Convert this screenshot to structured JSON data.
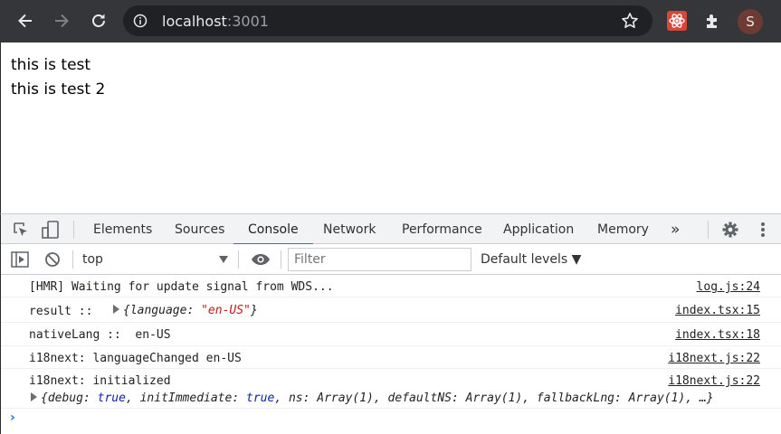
{
  "browser": {
    "url_host": "localhost",
    "url_port": ":3001",
    "avatar_letter": "S",
    "accent": "#1a73e8"
  },
  "page": {
    "lines": [
      "this is test",
      "this is test 2"
    ]
  },
  "devtools": {
    "tabs": [
      "Elements",
      "Sources",
      "Console",
      "Network",
      "Performance",
      "Application",
      "Memory"
    ],
    "active_tab": "Console",
    "overflow_label": "»",
    "context": "top",
    "filter_placeholder": "Filter",
    "levels_label": "Default levels ▼"
  },
  "console": {
    "rows": [
      {
        "message": "[HMR] Waiting for update signal from WDS...",
        "source": "log.js:24"
      },
      {
        "message": "result ::",
        "object_prefix": "{language: ",
        "object_value": "\"en-US\"",
        "object_suffix": "}",
        "source": "index.tsx:15"
      },
      {
        "message": "nativeLang ::  en-US",
        "source": "index.tsx:18"
      },
      {
        "message": "i18next: languageChanged en-US",
        "source": "i18next.js:22"
      },
      {
        "message": "i18next: initialized",
        "source": "i18next.js:22"
      }
    ],
    "expanded_object": {
      "open": "{debug: ",
      "debug_value": "true",
      "mid1": ", initImmediate: ",
      "init_value": "true",
      "rest": ", ns: Array(1), defaultNS: Array(1), fallbackLng: Array(1), …}"
    },
    "prompt_symbol": "›"
  }
}
